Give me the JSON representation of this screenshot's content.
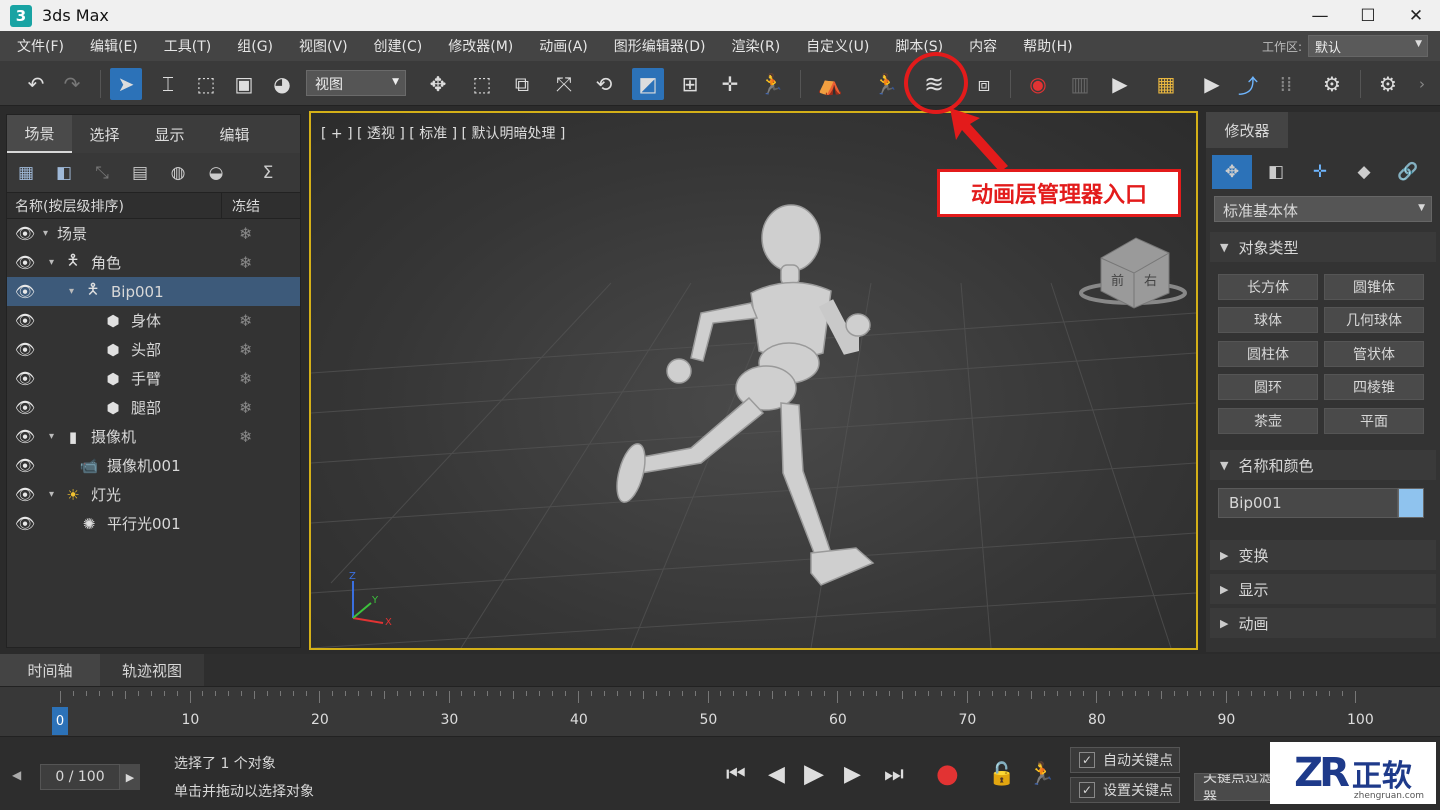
{
  "window": {
    "title": "3ds Max",
    "logo": "3",
    "min": "—",
    "max": "☐",
    "close": "✕"
  },
  "menu": [
    "文件(F)",
    "编辑(E)",
    "工具(T)",
    "组(G)",
    "视图(V)",
    "创建(C)",
    "修改器(M)",
    "动画(A)",
    "图形编辑器(D)",
    "渲染(R)",
    "自定义(U)",
    "脚本(S)",
    "内容",
    "帮助(H)"
  ],
  "workspace": {
    "label": "工作区:",
    "value": "默认"
  },
  "toolbar": {
    "view_dropdown": "视图"
  },
  "annotation": {
    "callout": "动画层管理器入口",
    "color": "#e31b1b"
  },
  "scene_explorer": {
    "tabs": [
      "场景",
      "选择",
      "显示",
      "编辑"
    ],
    "col_name": "名称(按层级排序)",
    "col_freeze": "冻结",
    "rows": [
      {
        "name": "场景"
      },
      {
        "name": "角色"
      },
      {
        "name": "Bip001"
      },
      {
        "name": "身体"
      },
      {
        "name": "头部"
      },
      {
        "name": "手臂"
      },
      {
        "name": "腿部"
      },
      {
        "name": "摄像机"
      },
      {
        "name": "摄像机001"
      },
      {
        "name": "灯光"
      },
      {
        "name": "平行光001"
      }
    ]
  },
  "viewport": {
    "label": "[ + ] [ 透视 ] [ 标准 ] [ 默认明暗处理 ]",
    "cube_front": "前",
    "cube_right": "右",
    "axis_x": "X",
    "axis_y": "Y",
    "axis_z": "Z"
  },
  "modify_panel": {
    "tab": "修改器",
    "category": "标准基本体",
    "section_object_type": "对象类型",
    "objects": [
      "长方体",
      "圆锥体",
      "球体",
      "几何球体",
      "圆柱体",
      "管状体",
      "圆环",
      "四棱锥",
      "茶壶",
      "平面"
    ],
    "section_name_color": "名称和颜色",
    "object_name": "Bip001",
    "object_color": "#8fc3ee",
    "sections": [
      "变换",
      "显示",
      "动画"
    ]
  },
  "timeline": {
    "tabs": [
      "时间轴",
      "轨迹视图"
    ],
    "current": "0",
    "labels": [
      "0",
      "10",
      "20",
      "30",
      "40",
      "50",
      "60",
      "70",
      "80",
      "90",
      "100"
    ]
  },
  "status": {
    "frame": "0 / 100",
    "line1": "选择了 1 个对象",
    "line2": "单击并拖动以选择对象",
    "auto_key": "自动关键点",
    "set_key": "设置关键点",
    "key_filter": "关键点过滤器"
  },
  "watermark": {
    "logo": "ZR",
    "name": "正软",
    "domain": "zhengruan.com"
  }
}
